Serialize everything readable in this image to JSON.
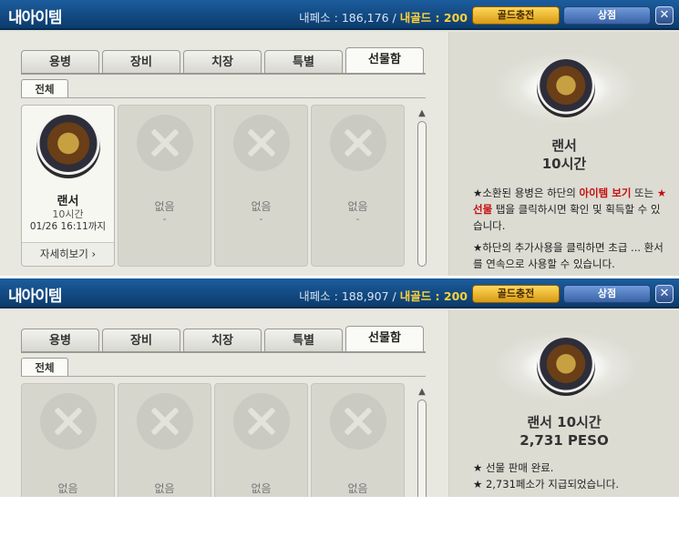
{
  "colors": {
    "title_bar": "#0b3b6c",
    "gold_text": "#ffd23a",
    "highlight_red": "#c41010"
  },
  "icons": {
    "item": "lancer-portrait-icon",
    "empty": "x-circle-icon",
    "close": "close-icon"
  },
  "panels": [
    {
      "title": "내아이템",
      "peso_label": "내페소 : 186,176 /",
      "gold_label": "내골드 : 200",
      "charge_button": "골드충전",
      "shop_button": "상점",
      "close_button": "✕",
      "tabs": [
        "용병",
        "장비",
        "치장",
        "특별",
        "선물함"
      ],
      "subtab": "전체",
      "slots": [
        {
          "name": "랜서",
          "duration": "10시간",
          "until": "01/26 16:11까지",
          "detail_button": "자세히보기 ›"
        },
        {
          "empty_label": "없음",
          "dash": "-"
        },
        {
          "empty_label": "없음",
          "dash": "-"
        },
        {
          "empty_label": "없음",
          "dash": "-"
        }
      ],
      "detail": {
        "name": "랜서",
        "duration": "10시간",
        "p1_star": "★",
        "p1_a": "소환된 용병은 하단의 ",
        "p1_hl": "아이템 보기",
        "p1_b": " 또는 ",
        "p1_hl2": "★선물",
        "p1_c": " 탭을 클릭하시면 확인 및 획득할 수 있습니다.",
        "p2": "★하단의 추가사용을 클릭하면 초급 ... 환서를 연속으로 사용할 수 있습니다."
      }
    },
    {
      "title": "내아이템",
      "peso_label": "내페소 : 188,907 /",
      "gold_label": "내골드 : 200",
      "charge_button": "골드충전",
      "shop_button": "상점",
      "close_button": "✕",
      "tabs": [
        "용병",
        "장비",
        "치장",
        "특별",
        "선물함"
      ],
      "subtab": "전체",
      "slots": [
        {
          "empty_label": "없음"
        },
        {
          "empty_label": "없음"
        },
        {
          "empty_label": "없음"
        },
        {
          "empty_label": "없음"
        }
      ],
      "detail": {
        "name_line": "랜서 10시간",
        "price": "2,731 PESO",
        "msg1": "★ 선물 판매 완료.",
        "msg2": "★ 2,731페소가 지급되었습니다."
      }
    }
  ]
}
